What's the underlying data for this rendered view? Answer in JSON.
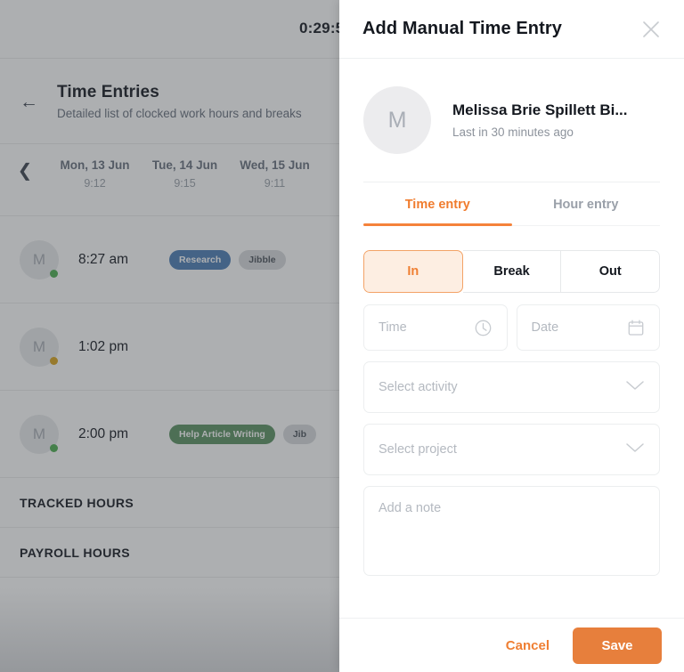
{
  "background": {
    "timer": "0:29:5",
    "page_title": "Time Entries",
    "page_subtitle": "Detailed list of clocked work hours and breaks",
    "back_icon": "arrow-left-icon",
    "prev_icon": "chevron-left-icon",
    "date_columns": [
      {
        "name": "Mon, 13 Jun",
        "hours": "9:12"
      },
      {
        "name": "Tue, 14 Jun",
        "hours": "9:15"
      },
      {
        "name": "Wed, 15 Jun",
        "hours": "9:11"
      }
    ],
    "entries": [
      {
        "initial": "M",
        "time": "8:27 am",
        "status": "green",
        "badges": [
          {
            "label": "Research",
            "color": "blue"
          },
          {
            "label": "Jibble",
            "color": "grey"
          }
        ]
      },
      {
        "initial": "M",
        "time": "1:02 pm",
        "status": "amber",
        "badges": []
      },
      {
        "initial": "M",
        "time": "2:00 pm",
        "status": "green",
        "badges": [
          {
            "label": "Help Article Writing",
            "color": "green"
          },
          {
            "label": "Jib",
            "color": "grey"
          }
        ]
      }
    ],
    "summary_rows": [
      {
        "label": "TRACKED HOURS"
      },
      {
        "label": "PAYROLL HOURS"
      }
    ]
  },
  "drawer": {
    "title": "Add Manual Time Entry",
    "close_icon": "close-icon",
    "user": {
      "initial": "M",
      "name": "Melissa Brie Spillett Bi...",
      "last_in": "Last in 30 minutes ago"
    },
    "tabs": [
      {
        "label": "Time entry",
        "active": true
      },
      {
        "label": "Hour entry",
        "active": false
      }
    ],
    "segments": [
      {
        "label": "In",
        "active": true
      },
      {
        "label": "Break",
        "active": false
      },
      {
        "label": "Out",
        "active": false
      }
    ],
    "fields": {
      "time_placeholder": "Time",
      "time_icon": "clock-icon",
      "date_placeholder": "Date",
      "date_icon": "calendar-icon",
      "activity_placeholder": "Select activity",
      "activity_icon": "chevron-down-icon",
      "project_placeholder": "Select project",
      "project_icon": "chevron-down-icon",
      "note_placeholder": "Add a note"
    },
    "footer": {
      "cancel_label": "Cancel",
      "save_label": "Save"
    }
  },
  "colors": {
    "accent": "#ef7f33",
    "save_bg": "#e77f3c",
    "badge_blue": "#4b7cb5",
    "badge_green": "#5a9161",
    "badge_grey": "#d7d9dc",
    "status_green": "#4caf50",
    "status_amber": "#d9a41c"
  }
}
